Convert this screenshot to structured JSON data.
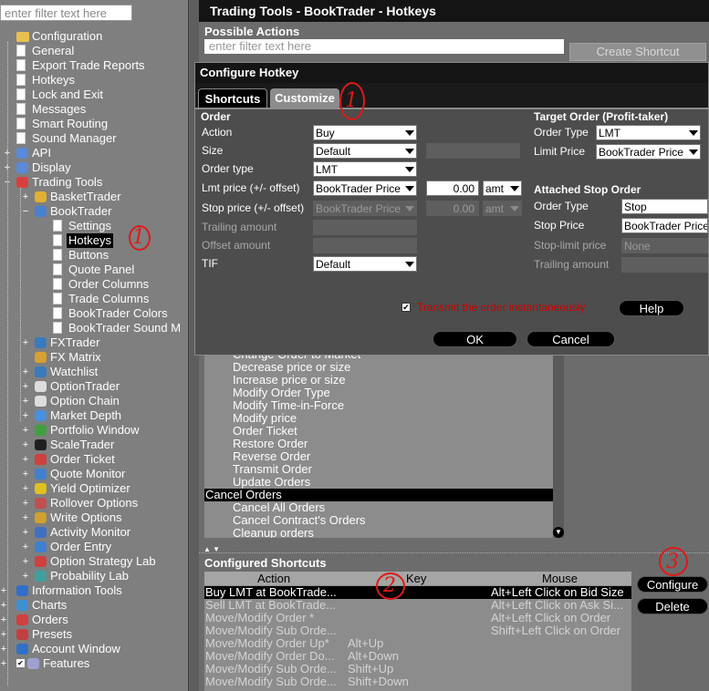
{
  "left_panel": {
    "filter_placeholder": "enter filter text here",
    "tree": [
      {
        "label": "Configuration",
        "level": 0,
        "icon": "folder-icon"
      },
      {
        "label": "General",
        "level": 1,
        "icon": "page-icon"
      },
      {
        "label": "Export Trade Reports",
        "level": 1,
        "icon": "page-icon"
      },
      {
        "label": "Hotkeys",
        "level": 1,
        "icon": "page-icon"
      },
      {
        "label": "Lock and Exit",
        "level": 1,
        "icon": "page-icon"
      },
      {
        "label": "Messages",
        "level": 1,
        "icon": "page-icon"
      },
      {
        "label": "Smart Routing",
        "level": 1,
        "icon": "page-icon"
      },
      {
        "label": "Sound Manager",
        "level": 1,
        "icon": "page-icon"
      },
      {
        "label": "API",
        "level": 1,
        "icon": "api-icon",
        "expandable": true
      },
      {
        "label": "Display",
        "level": 1,
        "icon": "display-icon",
        "expandable": true
      },
      {
        "label": "Trading Tools",
        "level": 1,
        "icon": "trading-tools-icon",
        "expanded": true
      },
      {
        "label": "BasketTrader",
        "level": 2,
        "icon": "basket-icon",
        "expandable": true
      },
      {
        "label": "BookTrader",
        "level": 2,
        "icon": "booktrader-icon",
        "expanded": true
      },
      {
        "label": "Settings",
        "level": 3,
        "icon": "page-icon"
      },
      {
        "label": "Hotkeys",
        "level": 3,
        "icon": "page-icon",
        "selected": true
      },
      {
        "label": "Buttons",
        "level": 3,
        "icon": "page-icon"
      },
      {
        "label": "Quote Panel",
        "level": 3,
        "icon": "page-icon"
      },
      {
        "label": "Order Columns",
        "level": 3,
        "icon": "page-icon"
      },
      {
        "label": "Trade Columns",
        "level": 3,
        "icon": "page-icon"
      },
      {
        "label": "BookTrader Colors",
        "level": 3,
        "icon": "page-icon"
      },
      {
        "label": "BookTrader Sound M",
        "level": 3,
        "icon": "page-icon"
      },
      {
        "label": "FXTrader",
        "level": 2,
        "icon": "fxtrader-icon",
        "expandable": true
      },
      {
        "label": "FX Matrix",
        "level": 2,
        "icon": "fx-matrix-icon"
      },
      {
        "label": "Watchlist",
        "level": 2,
        "icon": "watchlist-icon",
        "expandable": true
      },
      {
        "label": "OptionTrader",
        "level": 2,
        "icon": "option-icon",
        "expandable": true
      },
      {
        "label": "Option Chain",
        "level": 2,
        "icon": "option-icon",
        "expandable": true
      },
      {
        "label": "Market Depth",
        "level": 2,
        "icon": "market-depth-icon",
        "expandable": true
      },
      {
        "label": "Portfolio Window",
        "level": 2,
        "icon": "portfolio-icon",
        "expandable": true
      },
      {
        "label": "ScaleTrader",
        "level": 2,
        "icon": "scale-icon",
        "expandable": true
      },
      {
        "label": "Order Ticket",
        "level": 2,
        "icon": "order-ticket-icon",
        "expandable": true
      },
      {
        "label": "Quote Monitor",
        "level": 2,
        "icon": "quote-monitor-icon",
        "expandable": true
      },
      {
        "label": "Yield Optimizer",
        "level": 2,
        "icon": "yield-icon",
        "expandable": true
      },
      {
        "label": "Rollover Options",
        "level": 2,
        "icon": "rollover-icon",
        "expandable": true
      },
      {
        "label": "Write Options",
        "level": 2,
        "icon": "write-options-icon",
        "expandable": true
      },
      {
        "label": "Activity Monitor",
        "level": 2,
        "icon": "activity-icon",
        "expandable": true
      },
      {
        "label": "Order Entry",
        "level": 2,
        "icon": "order-entry-icon",
        "expandable": true
      },
      {
        "label": "Option Strategy Lab",
        "level": 2,
        "icon": "strategy-lab-icon",
        "expandable": true
      },
      {
        "label": "Probability Lab",
        "level": 2,
        "icon": "probability-icon",
        "expandable": true
      },
      {
        "label": "Information Tools",
        "level": 0,
        "icon": "info-icon",
        "expandable": true
      },
      {
        "label": "Charts",
        "level": 0,
        "icon": "chart-icon",
        "expandable": true
      },
      {
        "label": "Orders",
        "level": 0,
        "icon": "orders-icon",
        "expandable": true
      },
      {
        "label": "Presets",
        "level": 0,
        "icon": "presets-icon",
        "expandable": true
      },
      {
        "label": "Account Window",
        "level": 0,
        "icon": "account-icon",
        "expandable": true
      },
      {
        "label": "Features",
        "level": 0,
        "icon": "features-icon",
        "expandable": true,
        "checked": true
      }
    ]
  },
  "window_title": "Trading Tools - BookTrader - Hotkeys",
  "possible_actions": {
    "heading": "Possible Actions",
    "filter_placeholder": "enter filter text here",
    "create_button": "Create Shortcut",
    "items": [
      {
        "label": "Change Order to Market",
        "partial": true
      },
      {
        "label": "Decrease price or size"
      },
      {
        "label": "Increase price or size"
      },
      {
        "label": "Modify Order Type"
      },
      {
        "label": "Modify Time-in-Force"
      },
      {
        "label": "Modify price"
      },
      {
        "label": "Order Ticket"
      },
      {
        "label": "Restore Order"
      },
      {
        "label": "Reverse Order"
      },
      {
        "label": "Transmit Order"
      },
      {
        "label": "Update Orders"
      },
      {
        "label": "Cancel Orders",
        "selected": true
      },
      {
        "label": "Cancel All Orders"
      },
      {
        "label": "Cancel Contract's Orders"
      },
      {
        "label": "Cleanup orders"
      }
    ]
  },
  "configured_shortcuts": {
    "heading": "Configured Shortcuts",
    "columns": [
      "Action",
      "Key",
      "Mouse"
    ],
    "rows": [
      {
        "action": "Buy LMT at BookTrade...",
        "key": "",
        "mouse": "Alt+Left Click on Bid Size",
        "selected": true
      },
      {
        "action": "Sell LMT at BookTrade...",
        "key": "",
        "mouse": "Alt+Left Click on Ask Si..."
      },
      {
        "action": "Move/Modify Order *",
        "key": "",
        "mouse": "Alt+Left Click on Order"
      },
      {
        "action": "Move/Modify Sub Orde...",
        "key": "",
        "mouse": "Shift+Left Click on Order"
      },
      {
        "action": "Move/Modify Order Up*",
        "key": "Alt+Up",
        "mouse": ""
      },
      {
        "action": "Move/Modify Order Do...",
        "key": "Alt+Down",
        "mouse": ""
      },
      {
        "action": "Move/Modify Sub Orde...",
        "key": "Shift+Up",
        "mouse": ""
      },
      {
        "action": "Move/Modify Sub Orde...",
        "key": "Shift+Down",
        "mouse": ""
      }
    ],
    "configure_button": "Configure",
    "delete_button": "Delete"
  },
  "dialog": {
    "title": "Configure Hotkey",
    "tabs": [
      "Shortcuts",
      "Customize"
    ],
    "order": {
      "heading": "Order",
      "action_label": "Action",
      "action_value": "Buy",
      "size_label": "Size",
      "size_value": "Default",
      "order_type_label": "Order type",
      "order_type_value": "LMT",
      "lmt_label": "Lmt price (+/- offset)",
      "lmt_value": "BookTrader Price",
      "lmt_offset": "0.00",
      "lmt_unit": "amt",
      "stop_label": "Stop price (+/- offset)",
      "stop_value": "BookTrader Price",
      "stop_offset": "0.00",
      "stop_unit": "amt",
      "trailing_label": "Trailing amount",
      "offset_label": "Offset amount",
      "tif_label": "TIF",
      "tif_value": "Default"
    },
    "target": {
      "heading": "Target Order (Profit-taker)",
      "order_type_label": "Order Type",
      "order_type_value": "LMT",
      "limit_price_label": "Limit Price",
      "limit_price_value": "BookTrader Price"
    },
    "stop": {
      "heading": "Attached Stop Order",
      "order_type_label": "Order Type",
      "order_type_value": "Stop",
      "stop_price_label": "Stop Price",
      "stop_price_value": "BookTrader Price",
      "stop_limit_label": "Stop-limit price",
      "stop_limit_value": "None",
      "trailing_label": "Trailing amount"
    },
    "transmit_label": "Transmit the order instantaneously",
    "help_button": "Help",
    "ok_button": "OK",
    "cancel_button": "Cancel"
  },
  "annotations": [
    "1",
    "1",
    "2",
    "3"
  ],
  "colors": {
    "annotation": "#e01818",
    "selected_row": "#000000",
    "panel": "#7f7f7f"
  }
}
